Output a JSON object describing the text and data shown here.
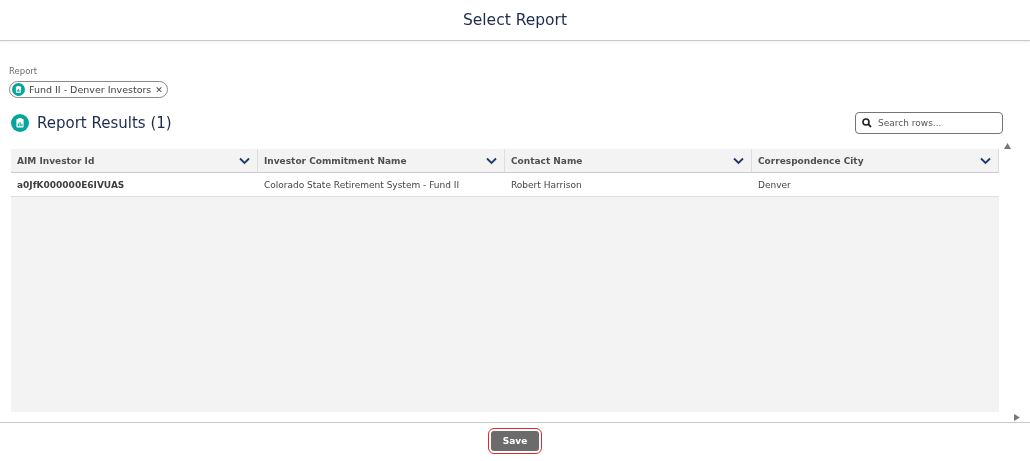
{
  "header": {
    "title": "Select Report"
  },
  "report_field": {
    "label": "Report",
    "pill": {
      "label": "Fund II - Denver Investors",
      "remove": "✕"
    }
  },
  "results": {
    "title": "Report Results (1)",
    "search": {
      "placeholder": "Search rows..."
    }
  },
  "table": {
    "columns": [
      "AIM Investor Id",
      "Investor Commitment Name",
      "Contact Name",
      "Correspondence City"
    ],
    "rows": [
      [
        "a0JfK000000E6IVUAS",
        "Colorado State Retirement System - Fund II",
        "Robert Harrison",
        "Denver"
      ]
    ]
  },
  "footer": {
    "save_button": {
      "label": "Save",
      "highlighted": true
    }
  }
}
